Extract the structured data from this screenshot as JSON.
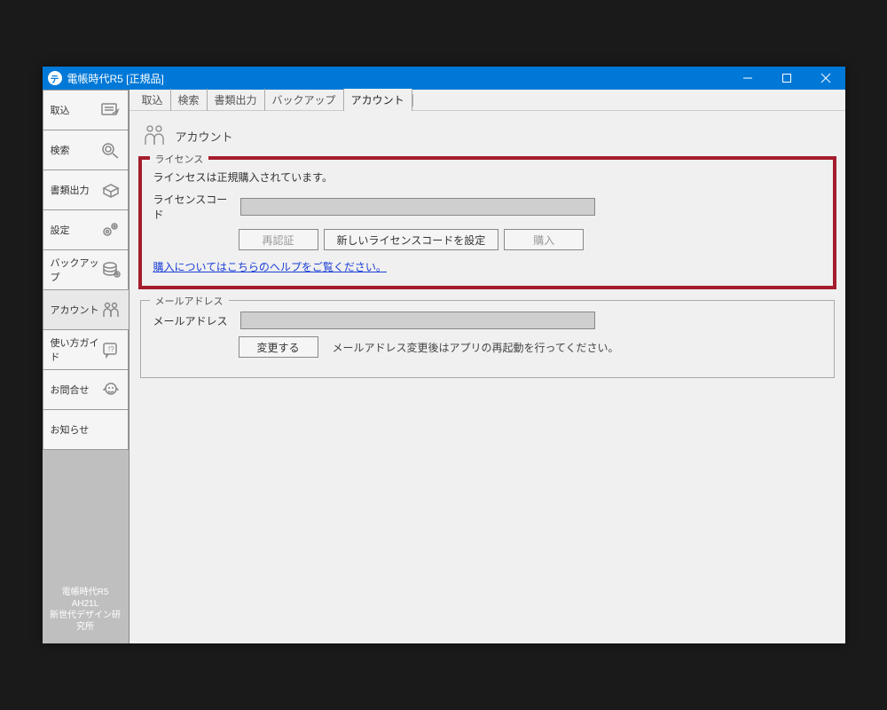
{
  "window": {
    "title": "電帳時代R5 [正規品]"
  },
  "sidebar": {
    "items": [
      {
        "label": "取込"
      },
      {
        "label": "検索"
      },
      {
        "label": "書類出力"
      },
      {
        "label": "設定"
      },
      {
        "label": "バックアップ"
      },
      {
        "label": "アカウント"
      },
      {
        "label": "使い方ガイド"
      },
      {
        "label": "お問合せ"
      },
      {
        "label": "お知らせ"
      }
    ],
    "footer": {
      "line1": "電帳時代R5",
      "line2": "AH21L",
      "line3": "新世代デザイン研究所"
    }
  },
  "tabs": [
    {
      "label": "取込"
    },
    {
      "label": "検索"
    },
    {
      "label": "書類出力"
    },
    {
      "label": "バックアップ"
    },
    {
      "label": "アカウント"
    }
  ],
  "page": {
    "title": "アカウント"
  },
  "license": {
    "legend": "ライセンス",
    "status": "ラインセスは正規購入されています。",
    "code_label": "ライセンスコード",
    "code_value": "",
    "btn_reauth": "再認証",
    "btn_newcode": "新しいライセンスコードを設定",
    "btn_purchase": "購入",
    "help_link": "購入についてはこちらのヘルプをご覧ください。"
  },
  "email": {
    "legend": "メールアドレス",
    "label": "メールアドレス",
    "value": "",
    "btn_change": "変更する",
    "note": "メールアドレス変更後はアプリの再起動を行ってください。"
  }
}
